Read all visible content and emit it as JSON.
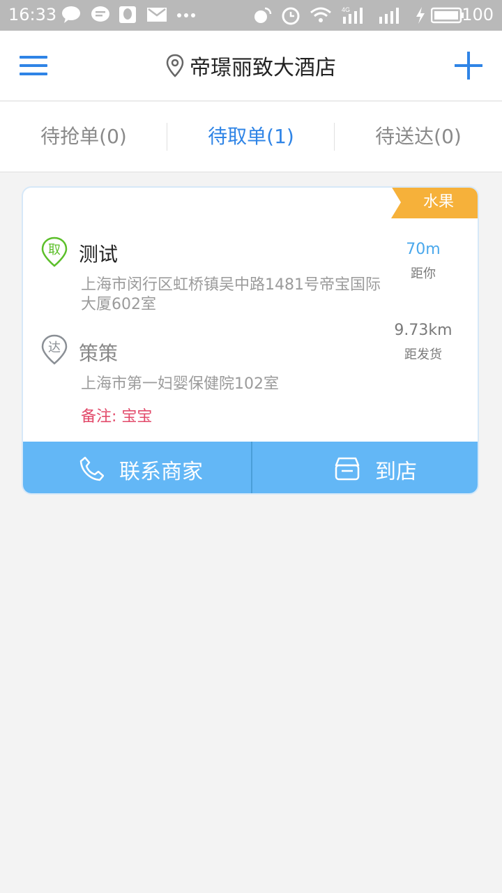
{
  "status_bar": {
    "time": "16:33",
    "network": "4G",
    "battery": "100"
  },
  "header": {
    "title": "帝璟丽致大酒店",
    "menu_icon": "menu-icon",
    "location_icon": "location-pin-icon",
    "add_icon": "plus-icon"
  },
  "tabs": [
    {
      "label": "待抢单(0)",
      "active": false
    },
    {
      "label": "待取单(1)",
      "active": true
    },
    {
      "label": "待送达(0)",
      "active": false
    }
  ],
  "order": {
    "tag": "水果",
    "pickup": {
      "badge": "取",
      "name": "测试",
      "address": "上海市闵行区虹桥镇吴中路1481号帝宝国际大厦602室",
      "distance": "70m",
      "distance_label": "距你"
    },
    "delivery": {
      "badge": "达",
      "name": "策策",
      "address": "上海市第一妇婴保健院102室",
      "distance": "9.73km",
      "distance_label": "距发货"
    },
    "note": "备注: 宝宝",
    "actions": {
      "contact": "联系商家",
      "arrive": "到店"
    }
  },
  "colors": {
    "accent": "#2f84e6",
    "action_bg": "#63b7f6",
    "tag": "#f6b13a",
    "pickup_green": "#5cbf2a",
    "note_red": "#e24a6a"
  }
}
